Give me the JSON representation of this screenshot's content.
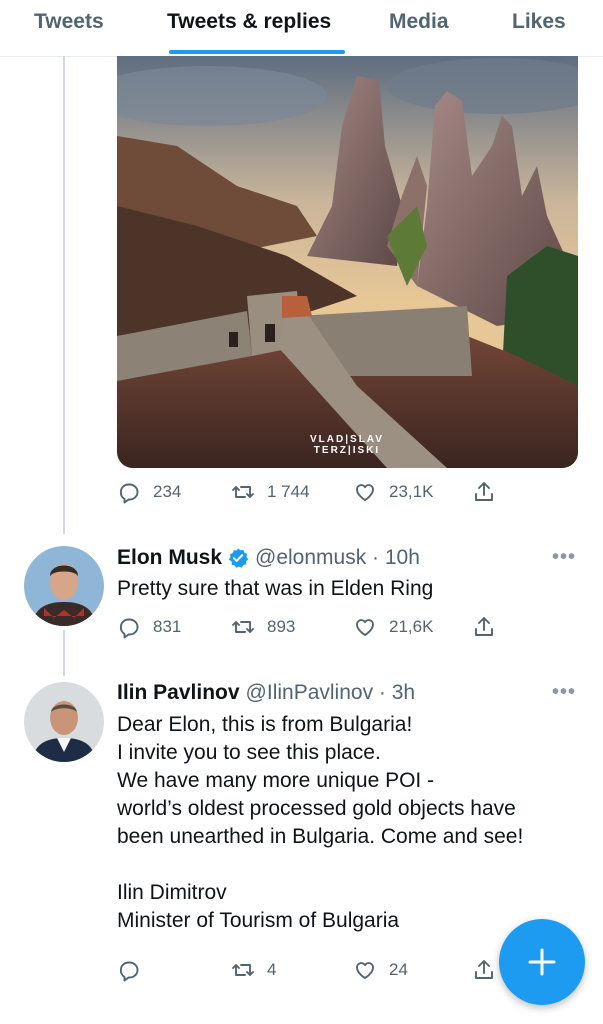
{
  "tabs": [
    {
      "label": "Tweets"
    },
    {
      "label": "Tweets & replies"
    },
    {
      "label": "Media"
    },
    {
      "label": "Likes"
    }
  ],
  "photo": {
    "watermark_line1": "VLAD|SLAV",
    "watermark_line2": "TERZ|ISKI"
  },
  "top_tweet": {
    "replies": "234",
    "retweets": "1 744",
    "likes": "23,1K"
  },
  "tweets": [
    {
      "name": "Elon Musk",
      "handle": "@elonmusk · 10h",
      "verified": true,
      "lines": [
        "Pretty sure that was in Elden Ring"
      ],
      "replies": "831",
      "retweets": "893",
      "likes": "21,6K"
    },
    {
      "name": "Ilin Pavlinov",
      "handle": "@IlinPavlinov · 3h",
      "verified": false,
      "lines": [
        "Dear Elon, this is from Bulgaria!",
        "I invite you to see this place.",
        "We have many more unique POI -",
        "world’s oldest processed gold objects have",
        "been unearthed in Bulgaria. Come and see!",
        "",
        "Ilin Dimitrov",
        "Minister of Tourism of Bulgaria"
      ],
      "replies": "",
      "retweets": "4",
      "likes": "24"
    }
  ],
  "colors": {
    "accent": "#1d9bf0",
    "secondary_text": "#536471"
  },
  "icons": [
    "reply-icon",
    "retweet-icon",
    "like-icon",
    "share-icon",
    "verified-icon",
    "more-icon",
    "compose-plus-icon"
  ]
}
